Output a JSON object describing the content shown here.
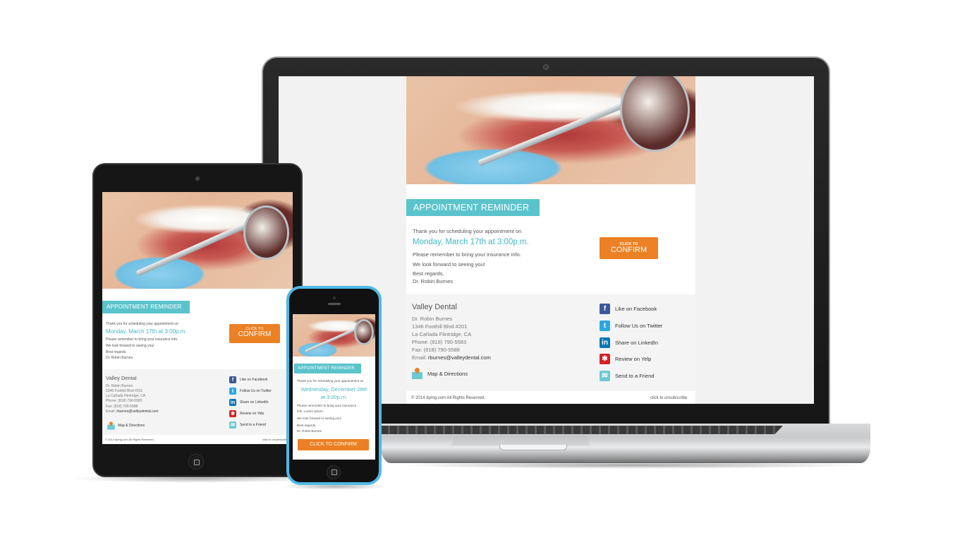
{
  "email": {
    "banner_tag": "APPOINTMENT REMINDER",
    "intro": "Thank you for scheduling your appointment on",
    "appointment_datetime": "Monday, March 17th at 3:00p.m.",
    "insurance_note": "Please remember to bring your insurance info.",
    "look_forward": "We look forward to seeing you!",
    "sign_off": "Best regards,",
    "doctor": "Dr. Robin Burnes",
    "confirm_button": {
      "small": "CLICK TO",
      "big": "CONFIRM"
    },
    "footer": {
      "practice_name": "Valley Dental",
      "doctor": "Dr. Robin Burnes",
      "address_line1": "1346 Foothill Blvd #201",
      "address_line2": "La Cañada Flintridge, CA",
      "phone": "Phone: (818) 790-5583",
      "fax": "Fax: (818) 790-5588",
      "email_label": "Email: ",
      "email_value": "rburnes@valleydental.com",
      "map_link": "Map & Directions",
      "social": [
        {
          "icon": "facebook-icon",
          "glyph": "f",
          "label": "Like on Facebook"
        },
        {
          "icon": "twitter-icon",
          "glyph": "t",
          "label": "Follow Us on Twitter"
        },
        {
          "icon": "linkedin-icon",
          "glyph": "in",
          "label": "Share on LinkedIn"
        },
        {
          "icon": "yelp-icon",
          "glyph": "✱",
          "label": "Review on Yelp"
        },
        {
          "icon": "mail-icon",
          "glyph": "✉",
          "label": "Send to a Friend"
        }
      ]
    },
    "copyright": "© 2014 dpmg.com  All Rights Reserved.",
    "unsubscribe": "click to unsubscribe"
  },
  "phone_email": {
    "banner_tag": "APPOINTMENT REMINDER",
    "intro": "Thank you for scheduling your appointment on",
    "date_line1": "Wednesday, December 28th",
    "date_line2": "at 3:00p.m.",
    "insurance_line1": "Please remember to bring your insurance",
    "insurance_line2": "info. Lorem Ipsum",
    "look_forward": "We look forward to seeing you!",
    "sign_off": "Best regards,",
    "doctor": "Dr. Robin Burnes",
    "confirm_button": "CLICK TO CONFIRM"
  },
  "colors": {
    "teal": "#5bc3cc",
    "orange": "#ec8024",
    "footer_bg": "#f4f4f4",
    "phone_case": "#4fb8e6"
  }
}
